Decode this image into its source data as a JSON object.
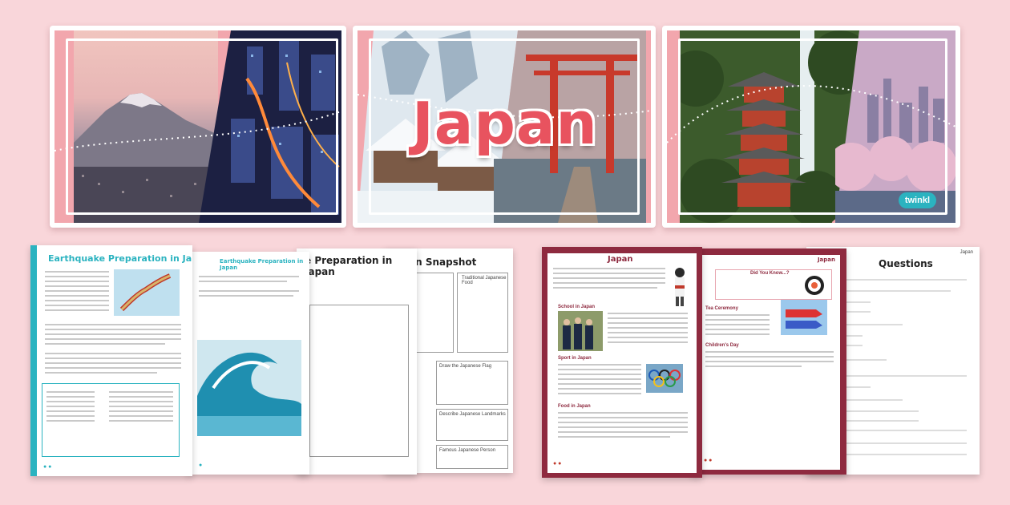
{
  "banner": {
    "title": "Japan",
    "logo": "twinkl"
  },
  "sheets": {
    "earthquake_main": {
      "title": "Earthquake Preparation in Japan",
      "accent": "#2bb3c0"
    },
    "earthquake_second": {
      "title": "Earthquake Preparation in Japan"
    },
    "earthquake_third": {
      "title": "e Preparation in Japan"
    },
    "snapshot": {
      "title": "an Snapshot",
      "boxes": [
        "Traditional Japanese Food",
        "Draw the Japanese Flag",
        "Describe Japanese Landmarks",
        "Famous Japanese Person"
      ]
    },
    "japan_fact": {
      "title": "Japan",
      "accent": "#8e2a3f",
      "headings": [
        "School in Japan",
        "Sport in Japan",
        "Food in Japan"
      ]
    },
    "japan_second": {
      "title": "Japan",
      "headings": [
        "Did You Know...?",
        "Tea Ceremony",
        "Children's Day"
      ]
    },
    "questions": {
      "title": "Questions",
      "corner": "Japan"
    }
  },
  "colors": {
    "background": "#f9d6da",
    "banner_accent": "#e8535f",
    "teal": "#2bb3c0",
    "maroon": "#8e2a3f"
  }
}
